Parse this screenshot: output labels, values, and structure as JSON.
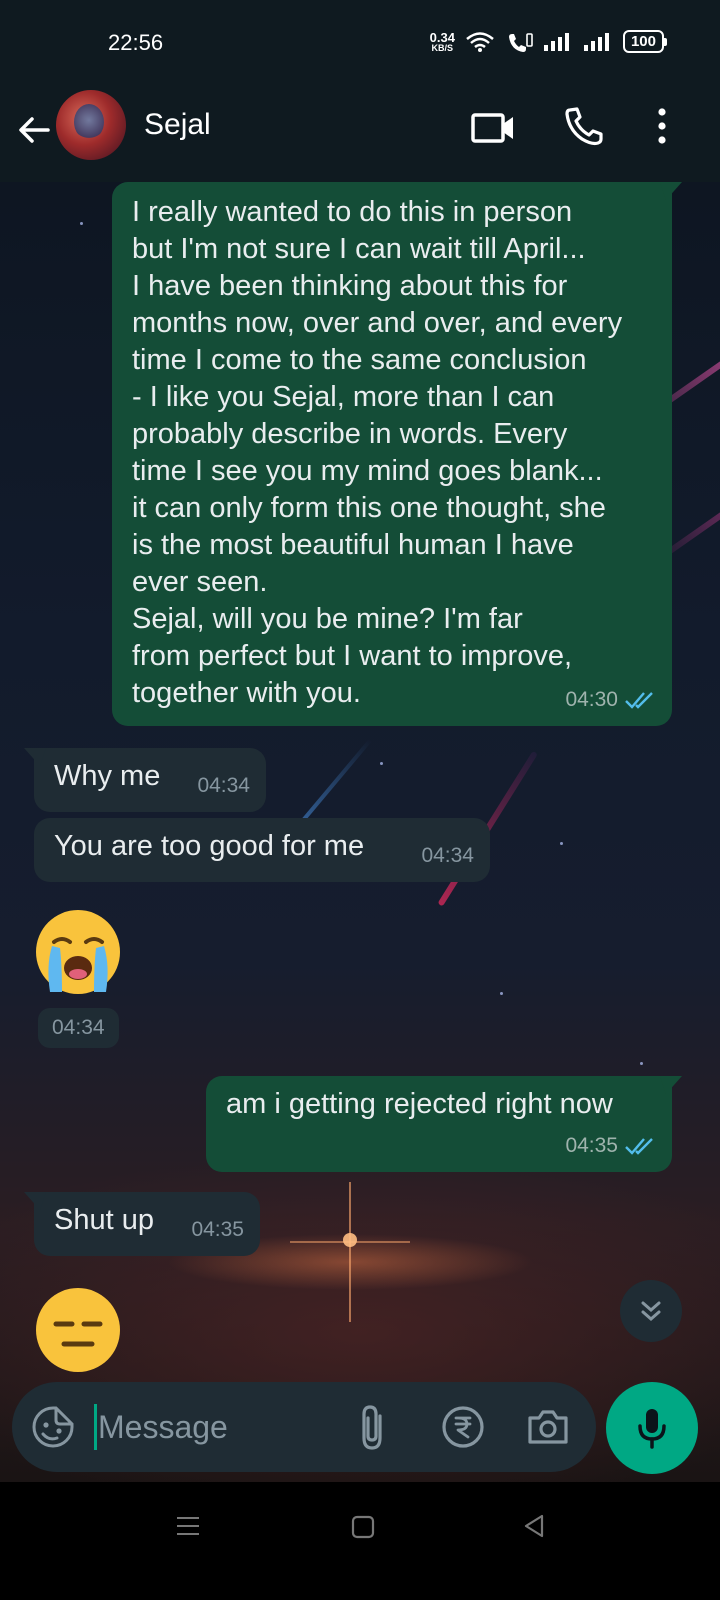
{
  "status_bar": {
    "time": "22:56",
    "net_speed": "0.34",
    "net_unit": "KB/S",
    "battery": "100"
  },
  "header": {
    "contact_name": "Sejal"
  },
  "messages": [
    {
      "direction": "out",
      "text": "I really wanted to do this in person\nbut I'm not sure I can wait till April...\nI have been thinking about this for\nmonths now, over and over, and every\ntime I come to the same conclusion\n- I like you Sejal, more than I can\nprobably describe in words. Every\ntime I see you my mind goes blank...\nit can only form this one thought, she\nis the most beautiful human I have\never seen.\nSejal, will you be mine? I'm far\nfrom perfect but I want to improve,\ntogether with you.",
      "time": "04:30",
      "status": "read"
    },
    {
      "direction": "in",
      "text": "Why me",
      "time": "04:34"
    },
    {
      "direction": "in",
      "text": "You are too good for me",
      "time": "04:34"
    },
    {
      "direction": "in",
      "emoji": "loudly-crying-face",
      "time": "04:34"
    },
    {
      "direction": "out",
      "text": "am i getting rejected right now",
      "time": "04:35",
      "status": "read"
    },
    {
      "direction": "in",
      "text": "Shut up",
      "time": "04:35"
    },
    {
      "direction": "in",
      "emoji": "expressionless-face"
    }
  ],
  "composer": {
    "placeholder": "Message"
  },
  "colors": {
    "outgoing_bubble": "#144d37",
    "incoming_bubble": "#1f2c34",
    "accent": "#00a884",
    "read_ticks": "#53bdeb"
  }
}
